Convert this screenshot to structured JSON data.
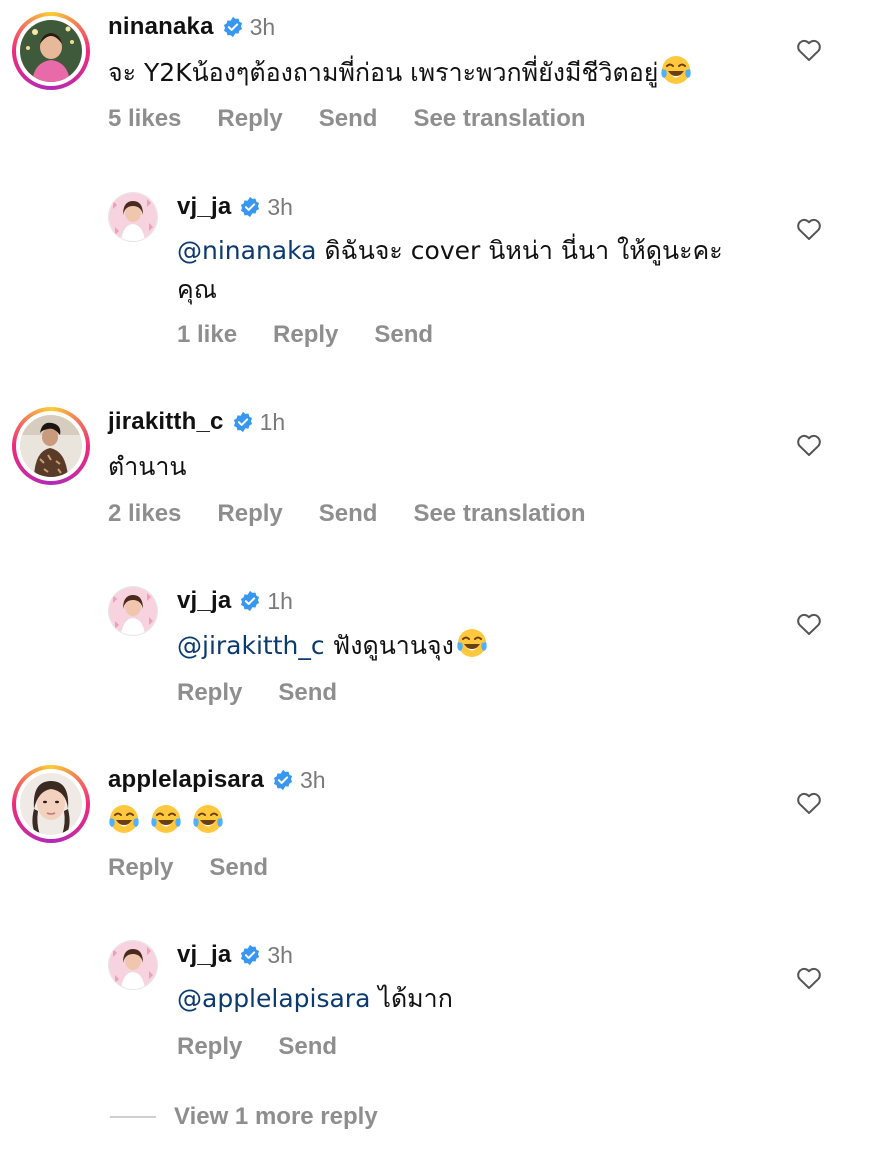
{
  "comments": [
    {
      "username": "ninanaka",
      "time": "3h",
      "text": "จะ Y2Kน้องๆต้องถามพี่ก่อน เพราะพวกพี่ยังมีชีวิตอยู่",
      "likes": "5 likes",
      "reply": "Reply",
      "send": "Send",
      "see_translation": "See translation",
      "trailing_emoji": "face-with-tears-of-joy"
    },
    {
      "username": "vj_ja",
      "time": "3h",
      "mention": "@ninanaka",
      "text_line1": " ดิฉันจะ cover นิหน่า นี่นา ให้ดูนะคะ",
      "text_line2": "คุณ",
      "likes": "1 like",
      "reply": "Reply",
      "send": "Send"
    },
    {
      "username": "jirakitth_c",
      "time": "1h",
      "text": "ตำนาน",
      "likes": "2 likes",
      "reply": "Reply",
      "send": "Send",
      "see_translation": "See translation"
    },
    {
      "username": "vj_ja",
      "time": "1h",
      "mention": "@jirakitth_c",
      "text": " ฟังดูนานจุง",
      "reply": "Reply",
      "send": "Send",
      "trailing_emoji": "face-with-tears-of-joy"
    },
    {
      "username": "applelapisara",
      "time": "3h",
      "emojis": [
        "face-with-tears-of-joy",
        "face-with-tears-of-joy",
        "face-with-tears-of-joy"
      ],
      "reply": "Reply",
      "send": "Send"
    },
    {
      "username": "vj_ja",
      "time": "3h",
      "mention": "@applelapisara",
      "text": " ได้มาก",
      "reply": "Reply",
      "send": "Send"
    }
  ],
  "view_more": "View 1 more reply",
  "colors": {
    "verified_blue": "#3897f0",
    "action_grey": "#8e8e8e",
    "mention_blue": "#0b3a6e",
    "story_ring": [
      "#f9ce34",
      "#ee2a7b",
      "#b02ab8"
    ]
  }
}
